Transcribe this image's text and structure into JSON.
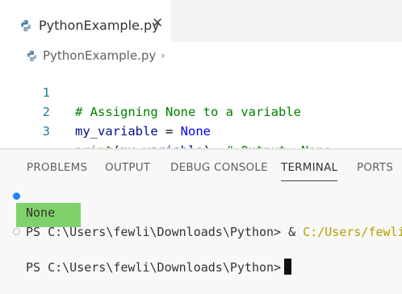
{
  "tab": {
    "title": "PythonExample.py",
    "close": "✕"
  },
  "breadcrumb": {
    "file": "PythonExample.py",
    "separator": "›"
  },
  "code": [
    {
      "num": "1",
      "comment": "# Assigning None to a variable"
    },
    {
      "num": "2",
      "var": "my_variable",
      "op": " = ",
      "kw": "None"
    },
    {
      "num": "3",
      "fn": "print",
      "open": "(",
      "arg": "my_variable",
      "close": ")",
      "comment": "  # Output: None"
    }
  ],
  "panel_tabs": [
    "PROBLEMS",
    "OUTPUT",
    "DEBUG CONSOLE",
    "TERMINAL",
    "PORTS"
  ],
  "active_panel_tab": "TERMINAL",
  "terminal": {
    "line1_prompt": "PS C:\\Users\\fewli\\Downloads\\Python> & ",
    "line1_path": "C:/Users/fewli",
    "output": "None",
    "line3_prompt": "PS C:\\Users\\fewli\\Downloads\\Python>"
  },
  "colors": {
    "accent": "#1a85ff",
    "output_highlight": "#7fd26b",
    "comment": "#008000",
    "keyword": "#0000ff"
  },
  "icons": [
    "python-file-icon",
    "close-icon"
  ]
}
